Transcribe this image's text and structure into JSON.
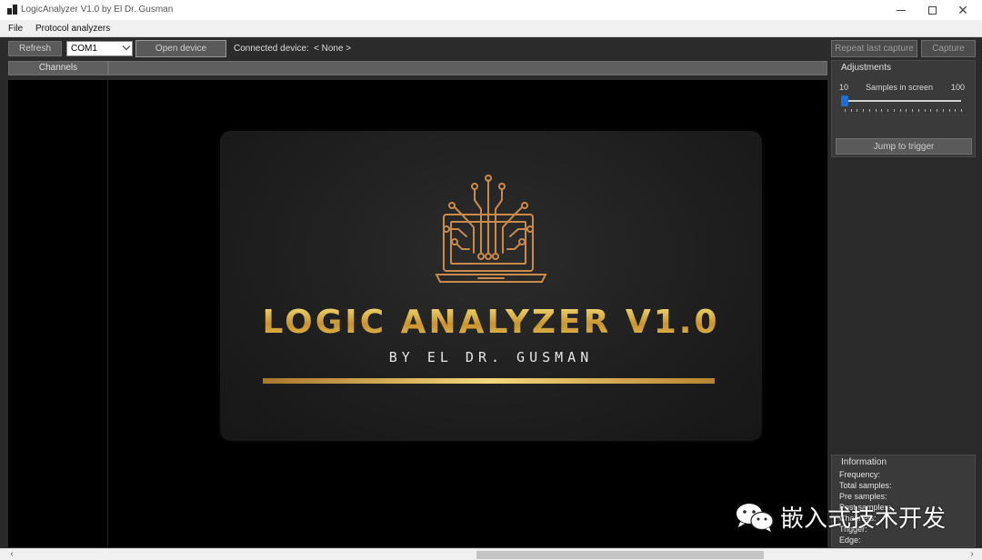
{
  "window": {
    "title": "LogicAnalyzer V1.0 by El Dr. Gusman"
  },
  "menu": {
    "items": [
      "File",
      "Protocol analyzers"
    ]
  },
  "toolbar": {
    "refresh": "Refresh",
    "port_value": "COM1",
    "open_device": "Open device",
    "connected_label": "Connected device:",
    "connected_value": "< None >",
    "repeat_capture": "Repeat last capture",
    "capture": "Capture"
  },
  "channels": {
    "header": "Channels"
  },
  "splash": {
    "title": "LOGIC  ANALYZER V1.0",
    "subtitle": "BY EL DR. GUSMAN",
    "accent_color": "#d4a443",
    "logo_icon": "circuit-laptop-icon"
  },
  "adjustments": {
    "title": "Adjustments",
    "min": "10",
    "label": "Samples in screen",
    "max": "100",
    "slider_value": 10,
    "jump_to_trigger": "Jump to trigger"
  },
  "information": {
    "title": "Information",
    "lines": [
      "Frequency:",
      "Total samples:",
      "Pre samples:",
      "Post samples:",
      "Channels:",
      "Trigger:",
      "Edge:"
    ]
  },
  "watermark": {
    "text": "嵌入式技术开发",
    "icon": "wechat-icon"
  }
}
